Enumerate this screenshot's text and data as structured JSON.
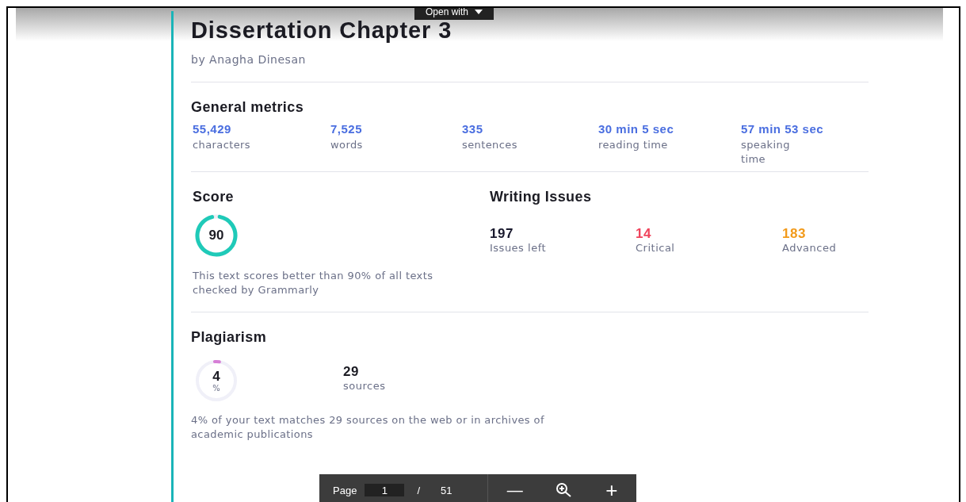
{
  "viewer": {
    "open_with": "Open with",
    "page_label": "Page",
    "page": "1",
    "page_sep": "/",
    "page_count": "51",
    "zoom_out": "—",
    "zoom_in": "+"
  },
  "document": {
    "title": "Dissertation Chapter 3",
    "author": "by Anagha Dinesan"
  },
  "general_metrics": {
    "heading": "General metrics",
    "items": [
      {
        "value": "55,429",
        "label": "characters"
      },
      {
        "value": "7,525",
        "label": "words"
      },
      {
        "value": "335",
        "label": "sentences"
      },
      {
        "value": "30 min 5 sec",
        "label": "reading time"
      },
      {
        "value": "57 min 53 sec",
        "label": "speaking time"
      }
    ]
  },
  "score": {
    "heading": "Score",
    "value": "90",
    "description": "This text scores better than 90% of all texts checked by Grammarly"
  },
  "writing_issues": {
    "heading": "Writing Issues",
    "items": [
      {
        "value": "197",
        "label": "Issues left",
        "color": "#1a1a2e"
      },
      {
        "value": "14",
        "label": "Critical",
        "color": "#f0445c"
      },
      {
        "value": "183",
        "label": "Advanced",
        "color": "#f29a1a"
      }
    ]
  },
  "plagiarism": {
    "heading": "Plagiarism",
    "value": "4",
    "unit": "%",
    "sources": "29",
    "sources_label": "sources",
    "description": "4% of your text matches 29 sources on the web or in archives of academic publications"
  }
}
